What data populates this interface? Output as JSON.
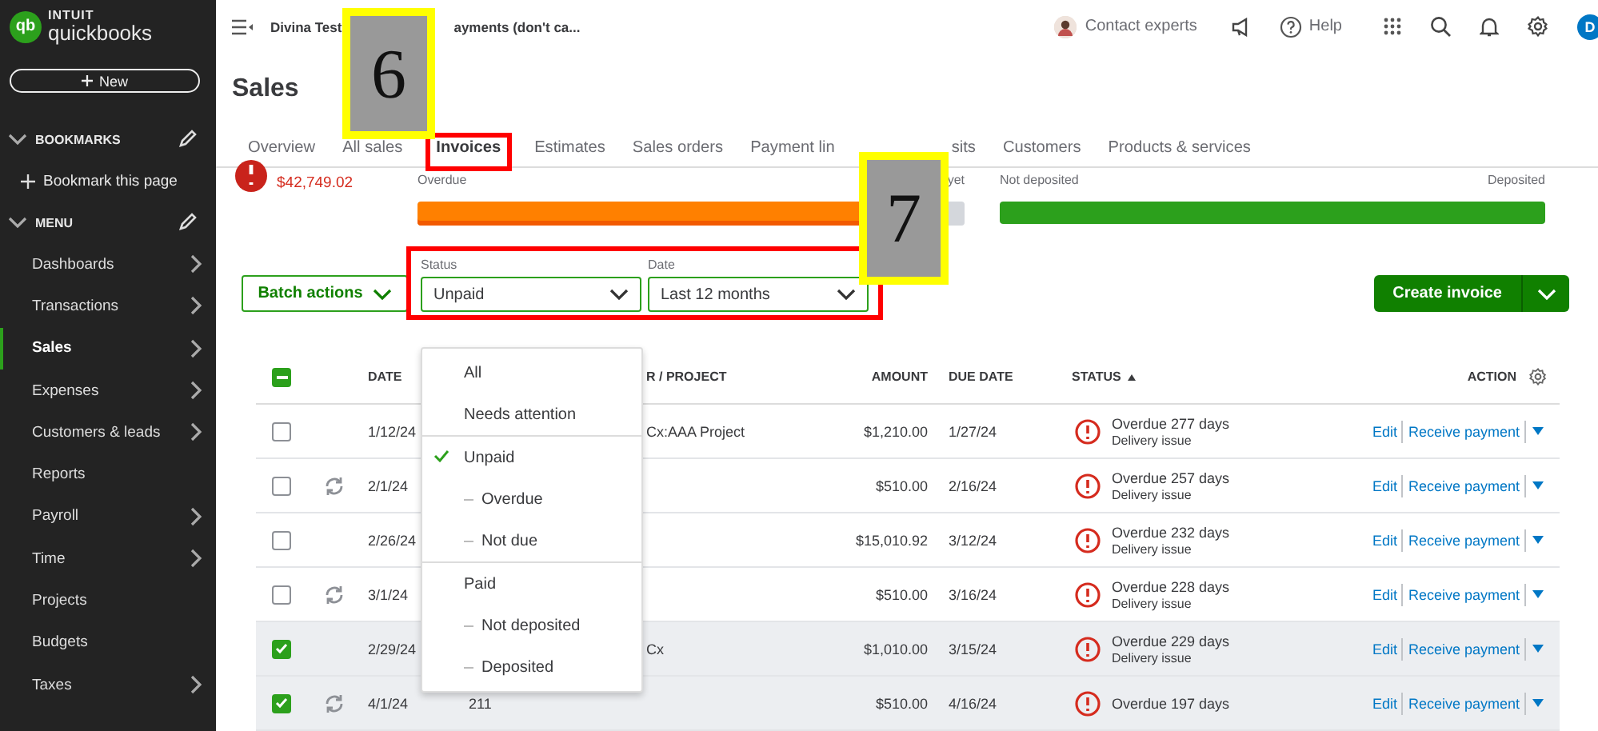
{
  "sidebar": {
    "logo": {
      "mark": "qb",
      "brand": "INTUIT",
      "product": "quickbooks"
    },
    "new_button": "New",
    "bookmarks": {
      "title": "BOOKMARKS",
      "items": [
        "Bookmark this page"
      ]
    },
    "menu": {
      "title": "MENU",
      "items": [
        {
          "label": "Dashboards",
          "has_submenu": true,
          "selected": false
        },
        {
          "label": "Transactions",
          "has_submenu": true,
          "selected": false
        },
        {
          "label": "Sales",
          "has_submenu": true,
          "selected": true
        },
        {
          "label": "Expenses",
          "has_submenu": true,
          "selected": false
        },
        {
          "label": "Customers & leads",
          "has_submenu": true,
          "selected": false
        },
        {
          "label": "Reports",
          "has_submenu": false,
          "selected": false
        },
        {
          "label": "Payroll",
          "has_submenu": true,
          "selected": false
        },
        {
          "label": "Time",
          "has_submenu": true,
          "selected": false
        },
        {
          "label": "Projects",
          "has_submenu": false,
          "selected": false
        },
        {
          "label": "Budgets",
          "has_submenu": false,
          "selected": false
        },
        {
          "label": "Taxes",
          "has_submenu": true,
          "selected": false
        }
      ]
    }
  },
  "topbar": {
    "company": [
      "Divina Test",
      "ayments (don't ca..."
    ],
    "contact": "Contact experts",
    "help": "Help",
    "avatar": "D"
  },
  "page_title": "Sales",
  "tabs": [
    {
      "label": "Overview",
      "selected": false,
      "highlighted": false
    },
    {
      "label": "All sales",
      "selected": false,
      "highlighted": false
    },
    {
      "label": "Invoices",
      "selected": true,
      "highlighted": true
    },
    {
      "label": "Estimates",
      "selected": false,
      "highlighted": false
    },
    {
      "label": "Sales orders",
      "selected": false,
      "highlighted": false
    },
    {
      "label": "Payment lin",
      "selected": false,
      "highlighted": false
    },
    {
      "label": "sits",
      "selected": false,
      "highlighted": false
    },
    {
      "label": "Customers",
      "selected": false,
      "highlighted": false
    },
    {
      "label": "Products & services",
      "selected": false,
      "highlighted": false
    }
  ],
  "summary": {
    "overdue_amount": "$42,749.02",
    "unpaid_labels": [
      "Overdue",
      "yet"
    ],
    "unpaid_bar": {
      "level": 0.95
    },
    "paid_labels": [
      "Not deposited",
      "Deposited"
    ],
    "paid_bar": {
      "level": 1
    }
  },
  "filters": {
    "highlighted": true,
    "batch_button": "Batch actions",
    "status": {
      "label": "Status",
      "value": "Unpaid"
    },
    "date": {
      "label": "Date",
      "value": "Last 12 months"
    },
    "create_button": "Create invoice"
  },
  "status_menu": [
    {
      "kind": "option",
      "label": "All",
      "selected": false
    },
    {
      "kind": "option",
      "label": "Needs attention",
      "selected": false
    },
    {
      "kind": "divider"
    },
    {
      "kind": "option",
      "label": "Unpaid",
      "selected": true
    },
    {
      "kind": "suboption",
      "label": "Overdue",
      "selected": false
    },
    {
      "kind": "suboption",
      "label": "Not due",
      "selected": false
    },
    {
      "kind": "divider"
    },
    {
      "kind": "option",
      "label": "Paid",
      "selected": false
    },
    {
      "kind": "suboption",
      "label": "Not deposited",
      "selected": false
    },
    {
      "kind": "suboption",
      "label": "Deposited",
      "selected": false
    }
  ],
  "table": {
    "select_all_indeterminate": true,
    "columns": [
      {
        "kind": "date",
        "label": "DATE",
        "sorted": false
      },
      {
        "kind": "customer",
        "label": "R / PROJECT",
        "sorted": false
      },
      {
        "kind": "amount",
        "label": "AMOUNT",
        "sorted": false
      },
      {
        "kind": "due",
        "label": "DUE DATE",
        "sorted": false
      },
      {
        "kind": "status",
        "label": "STATUS",
        "sorted": true
      },
      {
        "kind": "action",
        "label": "ACTION",
        "sorted": false
      }
    ],
    "rows": [
      {
        "checked": false,
        "recurring": false,
        "date": "1/12/24",
        "customer": "Cx:AAA Project",
        "amount": "$1,210.00",
        "due_date": "1/27/24",
        "status": "Overdue 277 days",
        "status_note": "Delivery issue",
        "actions": [
          "Edit",
          "Receive payment"
        ]
      },
      {
        "checked": false,
        "recurring": true,
        "date": "2/1/24",
        "amount": "$510.00",
        "due_date": "2/16/24",
        "status": "Overdue 257 days",
        "status_note": "Delivery issue",
        "actions": [
          "Edit",
          "Receive payment"
        ]
      },
      {
        "checked": false,
        "recurring": false,
        "date": "2/26/24",
        "amount": "$15,010.92",
        "due_date": "3/12/24",
        "status": "Overdue 232 days",
        "status_note": "Delivery issue",
        "actions": [
          "Edit",
          "Receive payment"
        ]
      },
      {
        "checked": false,
        "recurring": true,
        "date": "3/1/24",
        "amount": "$510.00",
        "due_date": "3/16/24",
        "status": "Overdue 228 days",
        "status_note": "Delivery issue",
        "actions": [
          "Edit",
          "Receive payment"
        ]
      },
      {
        "checked": true,
        "recurring": false,
        "date": "2/29/24",
        "customer": "Cx",
        "amount": "$1,010.00",
        "due_date": "3/15/24",
        "status": "Overdue 229 days",
        "status_note": "Delivery issue",
        "actions": [
          "Edit",
          "Receive payment"
        ]
      },
      {
        "checked": true,
        "recurring": true,
        "date": "4/1/24",
        "number": "211",
        "amount": "$510.00",
        "due_date": "4/16/24",
        "status": "Overdue 197 days",
        "actions": [
          "Edit",
          "Receive payment"
        ]
      }
    ]
  },
  "callouts": [
    {
      "text": "6"
    },
    {
      "text": "7"
    }
  ]
}
